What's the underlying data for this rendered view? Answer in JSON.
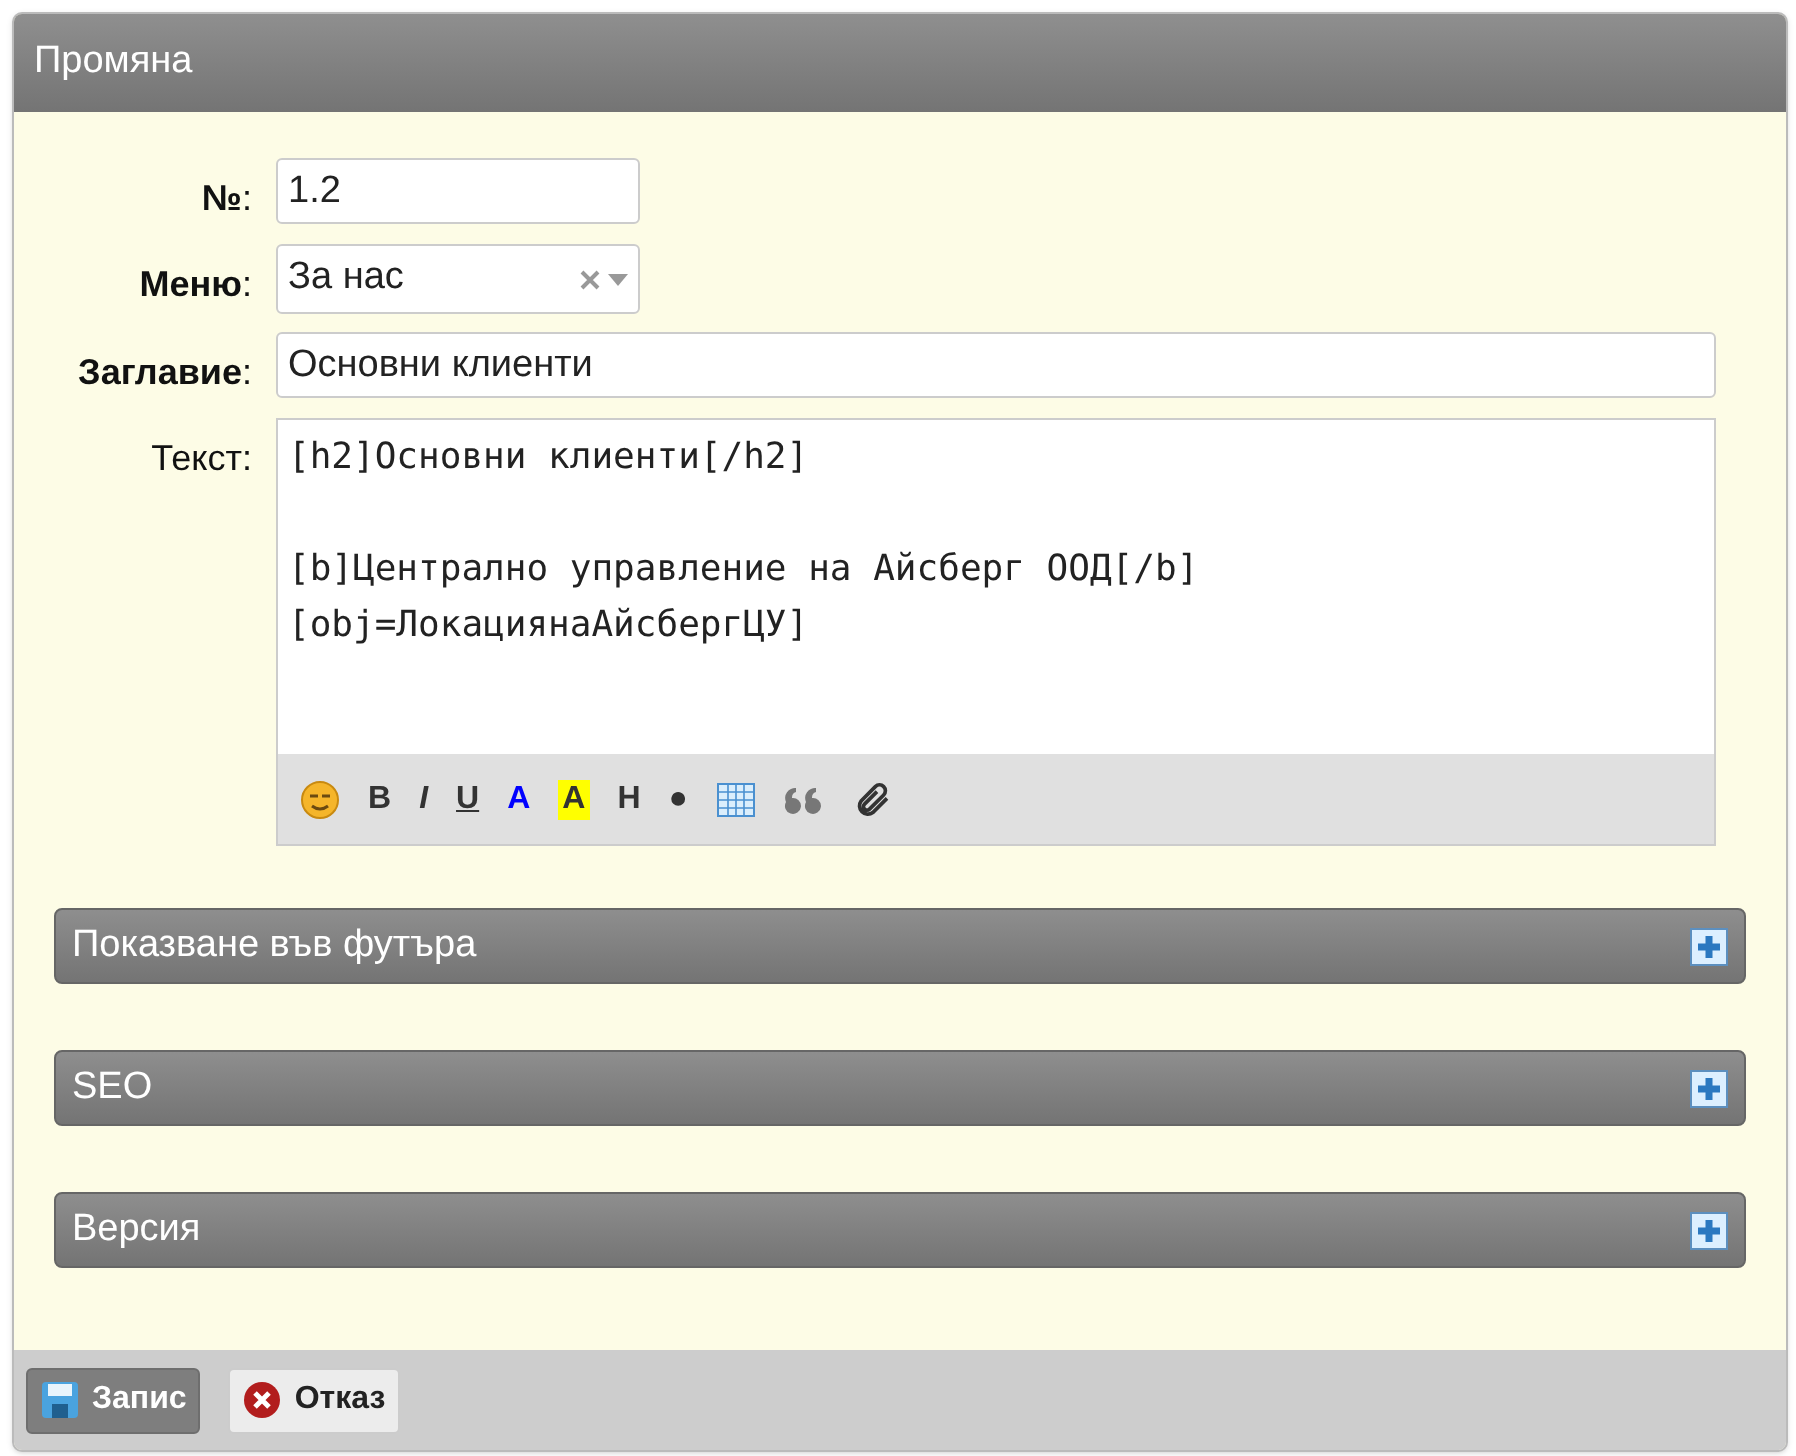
{
  "window": {
    "title": "Промяна"
  },
  "fields": [
    {
      "label": "**№**:",
      "kind": "input",
      "value": "1.2"
    },
    {
      "label": "**Меню**:",
      "kind": "select",
      "value": "За нас"
    },
    {
      "label": "**Заглавие**:",
      "kind": "wide",
      "value": "Основни клиенти"
    },
    {
      "label": "Текст:",
      "kind": "editor",
      "paragraphs": [
        [
          "[h2]Основни клиенти[/h2]"
        ],
        [
          "[b]Централно управление на Айсберг ООД[/b]",
          "[obj=ЛокациянаАйсбергЦУ]"
        ]
      ]
    }
  ],
  "toolbar": [
    {
      "kind": "emoji"
    },
    {
      "kind": "bold",
      "label": "B"
    },
    {
      "kind": "italic",
      "label": "I"
    },
    {
      "kind": "underline",
      "label": "U"
    },
    {
      "kind": "color",
      "label": "A"
    },
    {
      "kind": "highlight",
      "label": "A"
    },
    {
      "kind": "heading",
      "label": "H"
    },
    {
      "kind": "list",
      "label": "●"
    },
    {
      "kind": "table"
    },
    {
      "kind": "quote"
    },
    {
      "kind": "attach"
    }
  ],
  "sections": [
    {
      "title": "Показване във футъра",
      "expanded": false
    },
    {
      "title": "SEO",
      "expanded": false
    },
    {
      "title": "Версия",
      "expanded": false
    }
  ],
  "buttons": [
    {
      "kind": "save",
      "label": "Запис"
    },
    {
      "kind": "cancel",
      "label": "Отказ"
    }
  ]
}
